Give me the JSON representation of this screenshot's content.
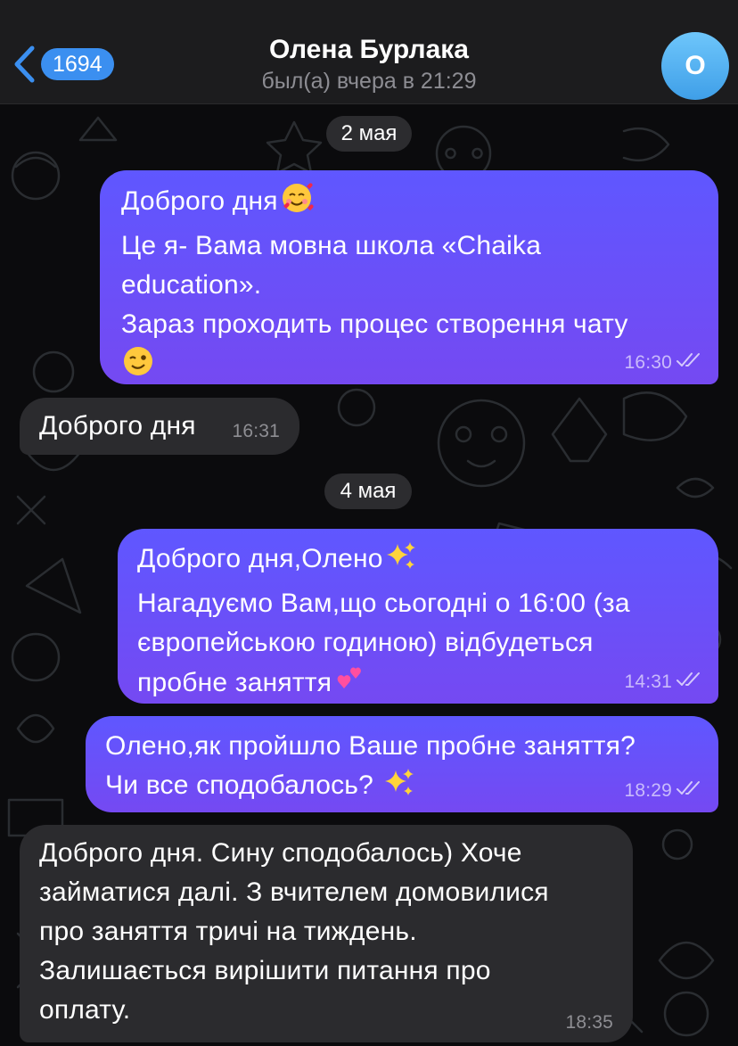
{
  "header": {
    "back_count": "1694",
    "contact_name": "Олена Бурлака",
    "status": "был(а) вчера в 21:29",
    "avatar_letter": "О"
  },
  "messages": {
    "date1": "2 мая",
    "m1": {
      "l1": "Доброго дня",
      "l2": "Це я- Вама мовна школа «Chaika",
      "l3": "education».",
      "l4": "Зараз проходить процес створення чату",
      "time": "16:30"
    },
    "m2": {
      "text": "Доброго дня",
      "time": "16:31"
    },
    "date2": "4 мая",
    "m3": {
      "l1": "Доброго дня,Олено",
      "l2": "Нагадуємо Вам,що сьогодні о 16:00 (за",
      "l3": "європейською годиною) відбудеться",
      "l4": "пробне заняття",
      "time": "14:31"
    },
    "m4": {
      "l1": "Олено,як пройшло Ваше пробне заняття?",
      "l2": "Чи все сподобалось?",
      "time": "18:29"
    },
    "m5": {
      "l1": "Доброго дня. Сину сподобалось) Хоче",
      "l2": "займатися далі. З вчителем домовилися",
      "l3": "про заняття тричі на тиждень.",
      "l4": "Залишається вирішити питання про",
      "l5": "оплату.",
      "time": "18:35"
    }
  },
  "icons": {
    "back": "chevron-left-icon",
    "read": "double-check-icon",
    "smiling_hearts": "smiling-face-with-hearts-icon",
    "wink": "winking-face-icon",
    "sparkles": "sparkles-icon",
    "two_hearts": "two-hearts-icon"
  },
  "colors": {
    "accent": "#3b8ff0",
    "outgoing_bubble": "#6a50f8",
    "incoming_bubble": "#2b2b2e",
    "header_bg": "#1c1c1e",
    "avatar": "#5ab6f5"
  }
}
